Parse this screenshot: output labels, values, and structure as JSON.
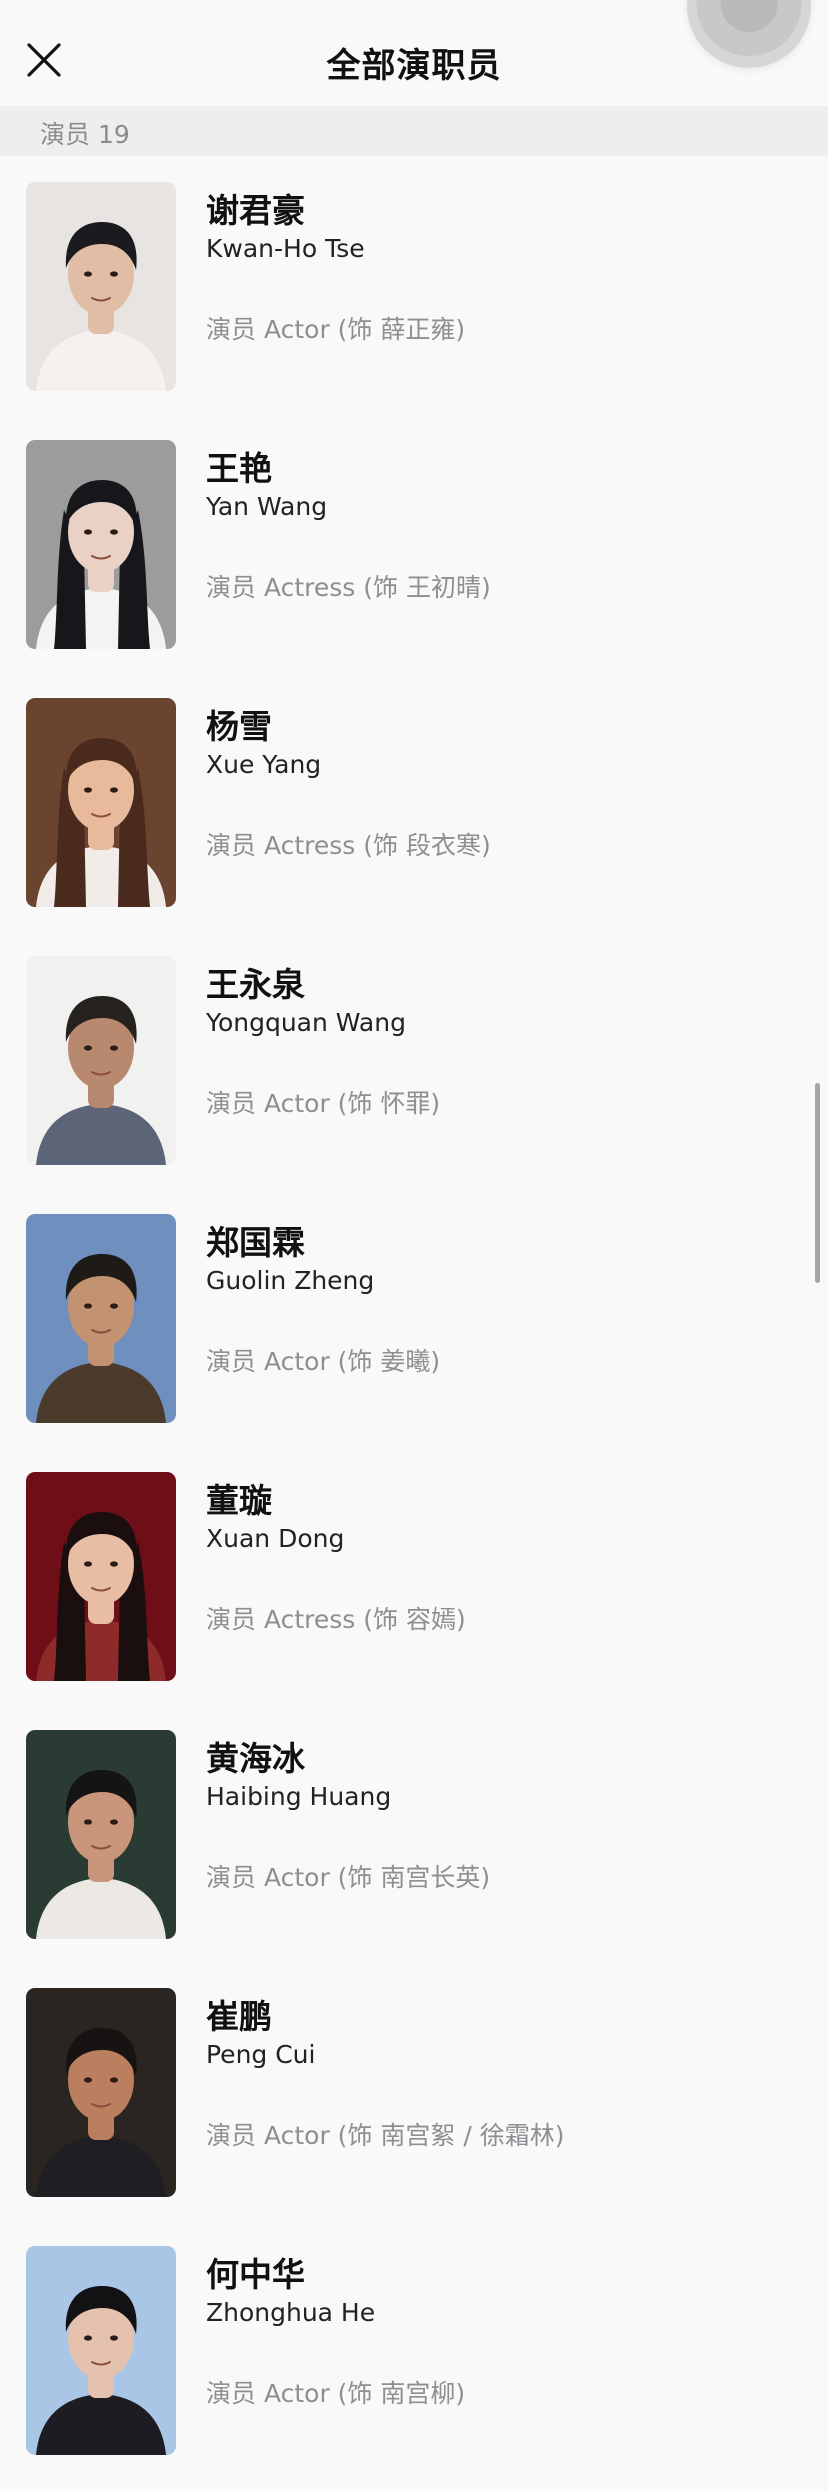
{
  "header": {
    "title": "全部演职员"
  },
  "section": {
    "label": "演员 19"
  },
  "cast": [
    {
      "name_cn": "谢君豪",
      "name_en": "Kwan-Ho Tse",
      "role": "演员 Actor (饰 薛正雍)",
      "colors": {
        "bg": "#e7e4e2",
        "hair": "#1b1b1f",
        "skin": "#e2bda6",
        "clothes": "#f4f1ee"
      }
    },
    {
      "name_cn": "王艳",
      "name_en": "Yan Wang",
      "role": "演员 Actress (饰 王初晴)",
      "colors": {
        "bg": "#9a9d9c",
        "hair": "#17161a",
        "skin": "#ead1c5",
        "clothes": "#f3f3f3"
      }
    },
    {
      "name_cn": "杨雪",
      "name_en": "Xue Yang",
      "role": "演员 Actress (饰 段衣寒)",
      "colors": {
        "bg": "#6b4430",
        "hair": "#4a2a1c",
        "skin": "#e8b99a",
        "clothes": "#f2ece8"
      }
    },
    {
      "name_cn": "王永泉",
      "name_en": "Yongquan Wang",
      "role": "演员 Actor (饰 怀罪)",
      "colors": {
        "bg": "#f1f1ef",
        "hair": "#26221f",
        "skin": "#b8896e",
        "clothes": "#5b6577"
      }
    },
    {
      "name_cn": "郑国霖",
      "name_en": "Guolin Zheng",
      "role": "演员 Actor (饰 姜曦)",
      "colors": {
        "bg": "#6f8fbf",
        "hair": "#1d1a18",
        "skin": "#c39270",
        "clothes": "#4b3b2c"
      }
    },
    {
      "name_cn": "董璇",
      "name_en": "Xuan Dong",
      "role": "演员 Actress (饰 容嫣)",
      "colors": {
        "bg": "#6e0f17",
        "hair": "#1a0e0e",
        "skin": "#e7bda4",
        "clothes": "#8f2a2a"
      }
    },
    {
      "name_cn": "黄海冰",
      "name_en": "Haibing Huang",
      "role": "演员 Actor (饰 南宫长英)",
      "colors": {
        "bg": "#2a3b34",
        "hair": "#141414",
        "skin": "#c9957b",
        "clothes": "#ece9e4"
      }
    },
    {
      "name_cn": "崔鹏",
      "name_en": "Peng Cui",
      "role": "演员 Actor (饰 南宫絮 / 徐霜林)",
      "colors": {
        "bg": "#2b2522",
        "hair": "#171312",
        "skin": "#b97f5e",
        "clothes": "#1f1f23"
      }
    },
    {
      "name_cn": "何中华",
      "name_en": "Zhonghua He",
      "role": "演员 Actor (饰 南宫柳)",
      "colors": {
        "bg": "#a9c6e6",
        "hair": "#121214",
        "skin": "#e5c2ad",
        "clothes": "#1c1c22"
      }
    }
  ]
}
